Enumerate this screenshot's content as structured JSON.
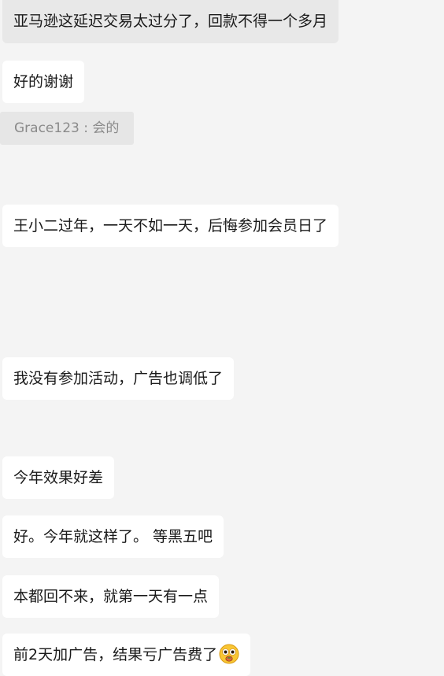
{
  "messages": [
    {
      "text": "亚马逊这延迟交易太过分了，回款不得一个多月"
    },
    {
      "text": "好的谢谢"
    },
    {
      "text": "王小二过年，一天不如一天，后悔参加会员日了"
    },
    {
      "text": "我没有参加活动，广告也调低了"
    },
    {
      "text": "今年效果好差"
    },
    {
      "text": "好。今年就这样了。 等黑五吧"
    },
    {
      "text": "本都回不来，就第一天有一点"
    },
    {
      "text": "前2天加广告，结果亏广告费了",
      "emoji": "money-mouth-face-icon"
    }
  ],
  "quote": {
    "author": "Grace123",
    "separator": " : ",
    "text": "会的"
  },
  "colors": {
    "background": "#f4f4f4",
    "bubble": "#ffffff",
    "quoted_bubble": "#e8e8e8",
    "quote_text": "#8a8a8a"
  }
}
